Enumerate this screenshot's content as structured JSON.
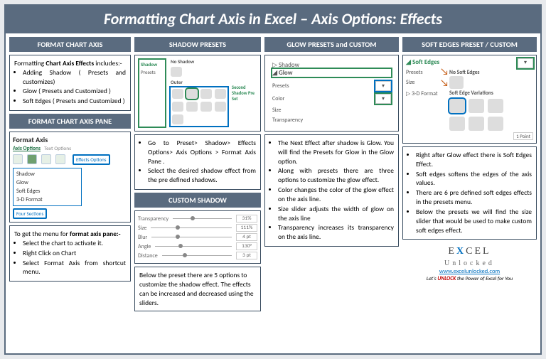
{
  "title": "Formatting Chart Axis in Excel – Axis Options: Effects",
  "col1": {
    "h1": "FORMAT CHART AXIS",
    "box1_intro": "Formatting Chart Axis Effects includes:-",
    "box1_items": [
      "Adding Shadow ( Presets and customizes)",
      "Glow ( Presets and Customized )",
      "Soft Edges ( Presets and Customized )"
    ],
    "h2": "FORMAT CHART AXIS PANE",
    "pane": {
      "title": "Format Axis",
      "tab1": "Axis Options",
      "tab2": "Text Options",
      "callout1": "Effects Options",
      "items": [
        "Shadow",
        "Glow",
        "Soft Edges",
        "3-D Format"
      ],
      "callout2": "Four Sections"
    },
    "box2_intro": "To get the menu for format axis pane:-",
    "box2_items": [
      "Select the chart to activate it.",
      "Right Click on Chart",
      "Select Format Axis from shortcut menu."
    ]
  },
  "col2": {
    "h1": "SHADOW PRESETS",
    "presets": {
      "sec1": "Shadow",
      "sec2": "Presets",
      "label_no": "No Shadow",
      "label_outer": "Outer",
      "callout": "Second Shadow Pre Set"
    },
    "box1_items": [
      "Go to Preset> Shadow> Effects Options> Axis Options > Format Axis Pane .",
      "Select the desired shadow effect from the pre defined shadows."
    ],
    "h2": "CUSTOM SHADOW",
    "sliders": [
      {
        "label": "Transparency",
        "val": "31%"
      },
      {
        "label": "Size",
        "val": "111%"
      },
      {
        "label": "Blur",
        "val": "4 pt"
      },
      {
        "label": "Angle",
        "val": "130°"
      },
      {
        "label": "Distance",
        "val": "3 pt"
      }
    ],
    "box2_text": "Below the preset there are 5 options to customize the shadow effect. The effects can be increased and decreased using the sliders."
  },
  "col3": {
    "h1": "GLOW PRESETS and CUSTOM",
    "pane": {
      "sec_shadow": "Shadow",
      "sec_glow": "Glow",
      "rows": [
        "Presets",
        "Color",
        "Size",
        "Transparency"
      ]
    },
    "box_items": [
      "The Next Effect after shadow is Glow. You will find the Presets for Glow in the Glow option.",
      "Along with presets there are three options to customize the glow effect.",
      "Color changes the color of the glow effect on the axis line.",
      "Size slider adjusts the width of glow on the axis line",
      "Transparency increases its transparency on the axis line."
    ]
  },
  "col4": {
    "h1": "SOFT EDGES PRESET / CUSTOM",
    "pane": {
      "sec": "Soft Edges",
      "presets": "Presets",
      "size": "Size",
      "sec3d": "3-D Format",
      "no_soft": "No Soft Edges",
      "variations": "Soft Edge Variations",
      "pt": "1 Point"
    },
    "box_items": [
      "Right after Glow effect there is Soft Edges Effect.",
      "Soft edges softens the edges of the axis values.",
      "There are 6 pre defined soft edges effects in the presets menu.",
      "Below the presets we will find the size slider that would be used to make custom soft edges effect."
    ],
    "logo": {
      "line1a": "E",
      "line1b": "CEL",
      "line2": "Unlocked",
      "link": "www.excelunlocked.com",
      "tag_pre": "Let's ",
      "tag_em": "UNLOCK",
      "tag_post": " the Power of Excel for You"
    }
  }
}
